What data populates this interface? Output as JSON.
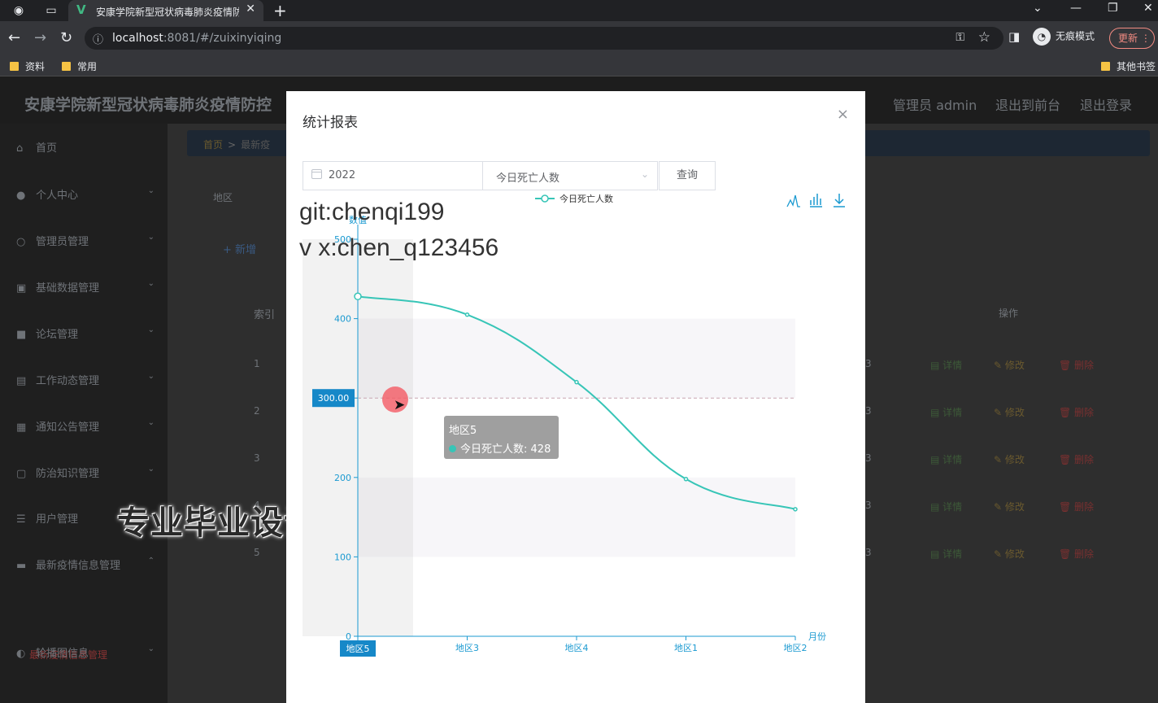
{
  "browser": {
    "tab_title": "安康学院新型冠状病毒肺炎疫情防控",
    "url_host": "localhost",
    "url_rest": ":8081/#/zuixinyiqing",
    "incognito_label": "无痕模式",
    "update_label": "更新",
    "bookmarks": [
      "资料",
      "常用"
    ],
    "other_bookmarks": "其他书签"
  },
  "app": {
    "title": "安康学院新型冠状病毒肺炎疫情防控",
    "header_links": [
      "管理员 admin",
      "退出到前台",
      "退出登录"
    ]
  },
  "sidebar": {
    "items": [
      {
        "label": "首页",
        "icon": "home-icon"
      },
      {
        "label": "个人中心",
        "icon": "user-icon"
      },
      {
        "label": "管理员管理",
        "icon": "admin-icon"
      },
      {
        "label": "基础数据管理",
        "icon": "data-icon"
      },
      {
        "label": "论坛管理",
        "icon": "forum-icon"
      },
      {
        "label": "工作动态管理",
        "icon": "work-icon"
      },
      {
        "label": "通知公告管理",
        "icon": "notice-icon"
      },
      {
        "label": "防治知识管理",
        "icon": "knowledge-icon"
      },
      {
        "label": "用户管理",
        "icon": "users-icon"
      },
      {
        "label": "最新疫情信息管理",
        "icon": "epidemic-icon"
      },
      {
        "label": "轮播图信息",
        "icon": "carousel-icon"
      }
    ],
    "active_sub": "最新疫情信息管理"
  },
  "content": {
    "breadcrumb": [
      "首页",
      "最新疫"
    ],
    "filter_label": "地区",
    "add_label": "新增",
    "col_index": "索引",
    "col_ops": "操作",
    "rows": [
      "1",
      "2",
      "3",
      "4",
      "5"
    ],
    "row_suffix": "3",
    "op_detail": "详情",
    "op_edit": "修改",
    "op_delete": "删除"
  },
  "watermark": {
    "line1": "git:chenqi199",
    "line2": "v x:chen_q123456",
    "banner": "专业毕业设计代做"
  },
  "modal": {
    "title": "统计报表",
    "close": "×",
    "year_value": "2022",
    "select_value": "今日死亡人数",
    "query_label": "查询"
  },
  "tooltip": {
    "title": "地区5",
    "series": "今日死亡人数",
    "value": "428"
  },
  "chart_data": {
    "type": "line",
    "smooth": true,
    "legend": "今日死亡人数",
    "legend_position": "top-center",
    "ylabel": "数值",
    "xlabel": "月份",
    "categories": [
      "地区5",
      "地区3",
      "地区4",
      "地区1",
      "地区2"
    ],
    "series": [
      {
        "name": "今日死亡人数",
        "values": [
          428,
          405,
          320,
          198,
          160
        ]
      }
    ],
    "ylim": [
      0,
      500
    ],
    "yticks": [
      0,
      100,
      200,
      300,
      400,
      500
    ],
    "crosshair_value": "300.00",
    "highlighted_category": "地区5",
    "color": "#37c5b7",
    "axis_color": "#1b9ad1",
    "toolbox": [
      "line-chart-icon",
      "bar-chart-icon",
      "download-icon"
    ]
  }
}
